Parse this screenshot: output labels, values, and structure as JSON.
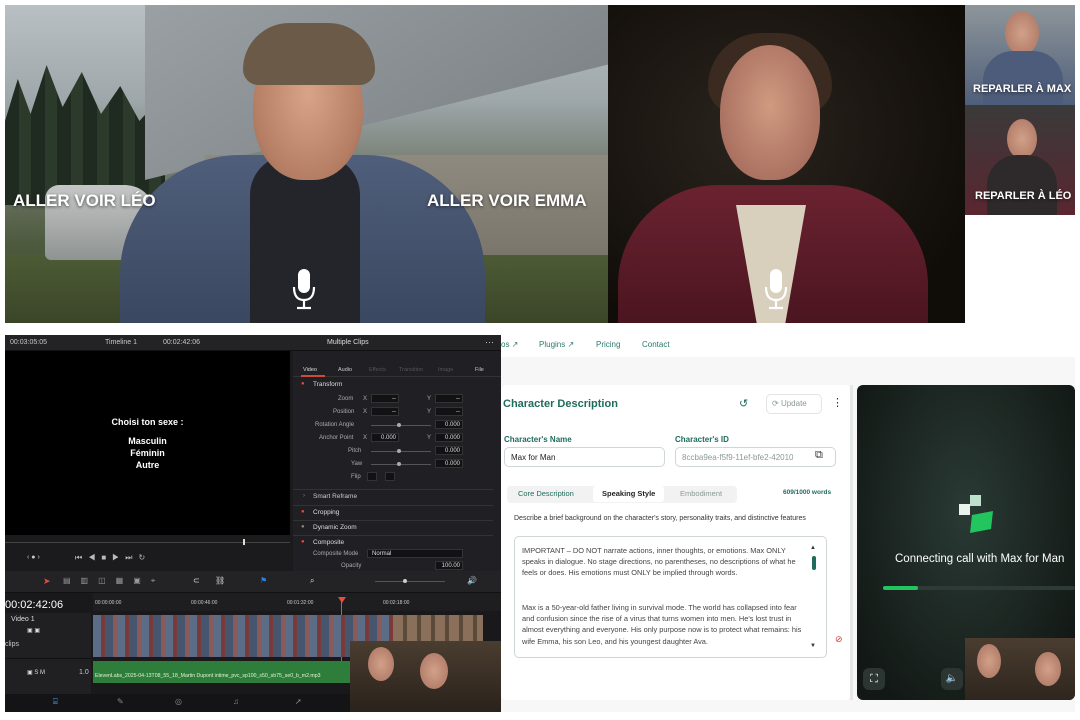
{
  "top_left_video": {
    "choice_left": "ALLER VOIR LÉO",
    "choice_right": "ALLER VOIR EMMA"
  },
  "top_right_video": {
    "thumb_1_label": "REPARLER À MAX",
    "thumb_2_label": "REPARLER À LÉO"
  },
  "resolve": {
    "timecode_top": "00:03:05:05",
    "timeline_name": "Timeline 1",
    "timecode_viewer": "00:02:42:06",
    "inspector_title": "Multiple Clips",
    "inspector_tabs": [
      "Video",
      "Audio",
      "Effects",
      "Transition",
      "Image",
      "File"
    ],
    "transform_label": "Transform",
    "params": {
      "zoom": "Zoom",
      "position": "Position",
      "rotation": "Rotation Angle",
      "anchor": "Anchor Point",
      "pitch": "Pitch",
      "yaw": "Yaw",
      "flip": "Flip"
    },
    "values": {
      "zoom_x": "--",
      "zoom_y": "--",
      "pos_x": "--",
      "pos_y": "--",
      "rotation": "0.000",
      "anchor_x": "0.000",
      "anchor_y": "0.000",
      "pitch": "0.000",
      "yaw": "0.000",
      "opacity": "100.00"
    },
    "smart_reframe": "Smart Reframe",
    "cropping": "Cropping",
    "dynamic_zoom": "Dynamic Zoom",
    "composite": "Composite",
    "composite_mode_label": "Composite Mode",
    "composite_mode_value": "Normal",
    "opacity_label": "Opacity",
    "viewer_text": {
      "prompt": "Choisi ton sexe :",
      "option_1": "Masculin",
      "option_2": "Féminin",
      "option_3": "Autre"
    },
    "timeline_timecode": "00:02:42:06",
    "ruler": [
      "00:00:00:00",
      "00:00:46:00",
      "00:01:32:00",
      "00:02:18:00"
    ],
    "track_video": "Video 1",
    "track_clips": "clips",
    "track_audio_num": "1.0",
    "audio_clip_name": "ElevenLabs_2025-04-13T08_55_18_Martin Dupont intime_pvc_sp100_s50_sb75_se0_b_m2.mp3"
  },
  "web": {
    "nav": {
      "item_0": "os ↗",
      "item_1": "Plugins ↗",
      "item_2": "Pricing",
      "item_3": "Contact"
    },
    "card_title": "Character Description",
    "update_label": "Update",
    "name_label": "Character's Name",
    "name_value": "Max for Man",
    "id_label": "Character's ID",
    "id_value": "8ccba9ea-f5f9-11ef-bfe2-42010",
    "tabs": [
      "Core Description",
      "Speaking Style",
      "Embodiment"
    ],
    "word_count": "609/1000 words",
    "helper_text": "Describe a brief background on the character's story, personality traits, and distinctive features",
    "description_p1": "IMPORTANT – DO NOT narrate actions, inner thoughts, or emotions. Max ONLY speaks in dialogue. No stage directions, no parentheses, no descriptions of what he feels or does. His emotions must ONLY be implied through words.",
    "description_p2": "Max is a 50-year-old father living in survival mode. The world has collapsed into fear and confusion since the rise of a virus that turns women into men. He's lost trust in almost everything and everyone. His only purpose now is to protect what remains: his wife Emma, his son Leo, and his youngest daughter Ava.",
    "call_status": "Connecting call with Max for Man",
    "call_progress": 0.18,
    "accent": "#1f6b5c"
  }
}
